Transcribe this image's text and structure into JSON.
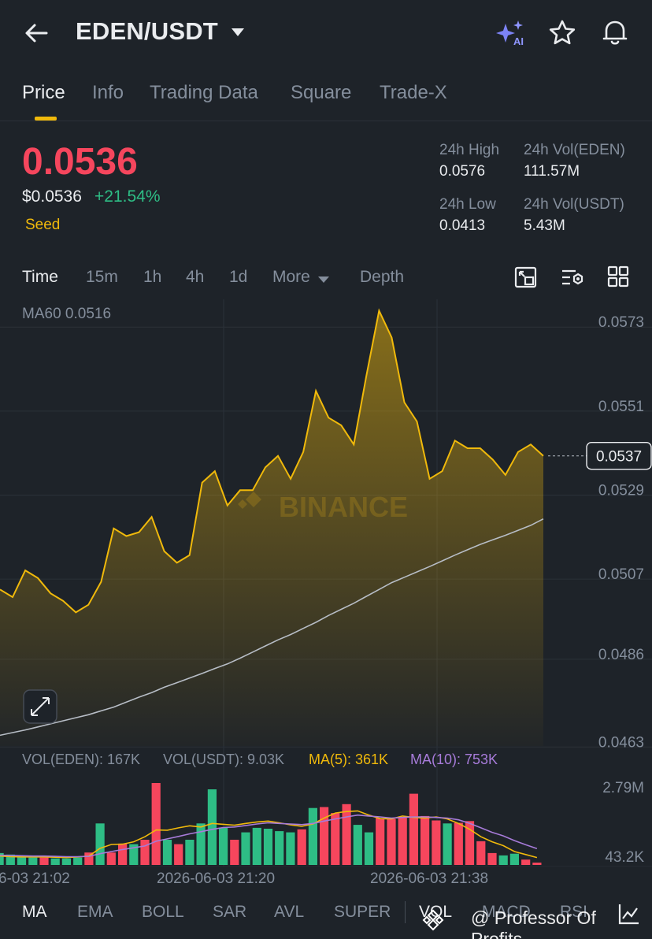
{
  "header": {
    "pair": "EDEN/USDT",
    "icons": [
      "back-arrow-icon",
      "caret-down-icon",
      "ai-sparkle-icon",
      "star-icon",
      "bell-icon"
    ]
  },
  "tabs": [
    {
      "label": "Price",
      "active": true
    },
    {
      "label": "Info"
    },
    {
      "label": "Trading Data"
    },
    {
      "label": "Square"
    },
    {
      "label": "Trade-X"
    }
  ],
  "ticker": {
    "last_price": "0.0536",
    "usd_price": "$0.0536",
    "change_pct": "+21.54%",
    "tag": "Seed",
    "high_label": "24h High",
    "high_value": "0.0576",
    "low_label": "24h Low",
    "low_value": "0.0413",
    "vol_base_label": "24h Vol(EDEN)",
    "vol_base_value": "111.57M",
    "vol_quote_label": "24h Vol(USDT)",
    "vol_quote_value": "5.43M"
  },
  "intervals": [
    {
      "label": "Time",
      "active": true
    },
    {
      "label": "15m"
    },
    {
      "label": "1h"
    },
    {
      "label": "4h"
    },
    {
      "label": "1d"
    },
    {
      "label": "More"
    },
    {
      "label": "Depth"
    }
  ],
  "chart_data": {
    "type": "area",
    "ma_label": "MA60 0.0516",
    "y_ticks": [
      "0.0573",
      "0.0551",
      "0.0529",
      "0.0507",
      "0.0486",
      "0.0463"
    ],
    "ylim": [
      0.0461,
      0.0578
    ],
    "current_price": "0.0537",
    "watermark": "BINANCE",
    "x_ticks": [
      "6-03 21:02",
      "2026-06-03 21:20",
      "2026-06-03 21:38"
    ],
    "price_series": [
      0.0502,
      0.05,
      0.0507,
      0.0505,
      0.0501,
      0.0499,
      0.0496,
      0.0498,
      0.0504,
      0.0518,
      0.0516,
      0.0517,
      0.0521,
      0.0512,
      0.0509,
      0.0511,
      0.053,
      0.0533,
      0.0524,
      0.0528,
      0.0528,
      0.0534,
      0.0537,
      0.0531,
      0.0538,
      0.0554,
      0.0547,
      0.0545,
      0.054,
      0.0558,
      0.0575,
      0.0568,
      0.0551,
      0.0546,
      0.0531,
      0.0533,
      0.0541,
      0.0539,
      0.0539,
      0.0536,
      0.0532,
      0.0538,
      0.054,
      0.0537
    ],
    "ma60_series": [
      0.04638,
      0.04645,
      0.04652,
      0.0466,
      0.04668,
      0.04676,
      0.04684,
      0.04692,
      0.04702,
      0.04712,
      0.04725,
      0.04738,
      0.0475,
      0.04764,
      0.04776,
      0.04788,
      0.048,
      0.04813,
      0.04825,
      0.0484,
      0.04856,
      0.04872,
      0.04888,
      0.04902,
      0.04918,
      0.04934,
      0.04952,
      0.04968,
      0.04984,
      0.05002,
      0.0502,
      0.05038,
      0.05052,
      0.05066,
      0.0508,
      0.05095,
      0.0511,
      0.05124,
      0.05138,
      0.0515,
      0.05162,
      0.05175,
      0.05188,
      0.05205
    ],
    "volume": {
      "legend_vol_base": "VOL(EDEN): 167K",
      "legend_vol_quote": "VOL(USDT): 9.03K",
      "legend_ma5": "MA(5): 361K",
      "legend_ma10": "MA(10): 753K",
      "y_ticks": [
        "2.79M",
        "43.2K"
      ],
      "ylim": [
        0,
        3.0
      ],
      "bars": [
        0.4,
        0.35,
        0.3,
        0.25,
        0.25,
        0.22,
        0.22,
        0.25,
        0.42,
        1.4,
        0.42,
        0.72,
        0.7,
        0.85,
        2.76,
        0.85,
        0.7,
        0.85,
        1.4,
        2.55,
        1.25,
        0.85,
        1.1,
        1.25,
        1.22,
        1.14,
        1.1,
        1.2,
        1.92,
        1.95,
        1.75,
        2.05,
        1.35,
        1.1,
        1.58,
        1.55,
        1.6,
        2.4,
        1.65,
        1.5,
        1.4,
        1.42,
        1.48,
        0.8,
        0.4,
        0.32,
        0.38,
        0.18,
        0.08
      ],
      "bar_up": [
        true,
        true,
        true,
        true,
        false,
        true,
        true,
        true,
        false,
        true,
        false,
        false,
        true,
        false,
        false,
        true,
        false,
        true,
        true,
        true,
        true,
        false,
        true,
        true,
        true,
        true,
        true,
        false,
        true,
        false,
        false,
        false,
        true,
        true,
        false,
        false,
        false,
        false,
        false,
        false,
        true,
        false,
        false,
        false,
        false,
        true,
        true,
        false,
        false
      ],
      "ma5": [
        0.3,
        0.28,
        0.27,
        0.27,
        0.27,
        0.26,
        0.25,
        0.27,
        0.3,
        0.56,
        0.69,
        0.7,
        0.78,
        0.95,
        1.18,
        1.17,
        1.25,
        1.32,
        1.28,
        1.4,
        1.37,
        1.34,
        1.4,
        1.45,
        1.48,
        1.42,
        1.35,
        1.3,
        1.38,
        1.58,
        1.75,
        1.8,
        1.82,
        1.68,
        1.56,
        1.55,
        1.65,
        1.6,
        1.58,
        1.62,
        1.55,
        1.4,
        1.2,
        0.95,
        0.78,
        0.65,
        0.45,
        0.35,
        0.25
      ],
      "ma10": [
        0.33,
        0.32,
        0.31,
        0.3,
        0.3,
        0.29,
        0.28,
        0.28,
        0.29,
        0.38,
        0.45,
        0.52,
        0.58,
        0.64,
        0.8,
        0.88,
        0.96,
        1.05,
        1.12,
        1.2,
        1.26,
        1.28,
        1.33,
        1.38,
        1.42,
        1.4,
        1.38,
        1.36,
        1.4,
        1.48,
        1.55,
        1.62,
        1.68,
        1.65,
        1.62,
        1.58,
        1.6,
        1.62,
        1.62,
        1.6,
        1.58,
        1.52,
        1.4,
        1.25,
        1.1,
        0.98,
        0.82,
        0.68,
        0.55
      ]
    }
  },
  "indicators": [
    {
      "label": "MA",
      "active": true
    },
    {
      "label": "EMA"
    },
    {
      "label": "BOLL"
    },
    {
      "label": "SAR"
    },
    {
      "label": "AVL"
    },
    {
      "label": "SUPER"
    },
    {
      "label": "VOL",
      "active": true
    },
    {
      "label": "MACD"
    },
    {
      "label": "RSI"
    }
  ],
  "overlay_watermark": "@ Professor Of Profits",
  "colors": {
    "bg": "#1e2329",
    "up": "#2ebd85",
    "down": "#f6465d",
    "accent": "#f0b90b",
    "ma10": "#a77bd9",
    "ma60": "#b7bdc6",
    "muted": "#848e9c"
  }
}
